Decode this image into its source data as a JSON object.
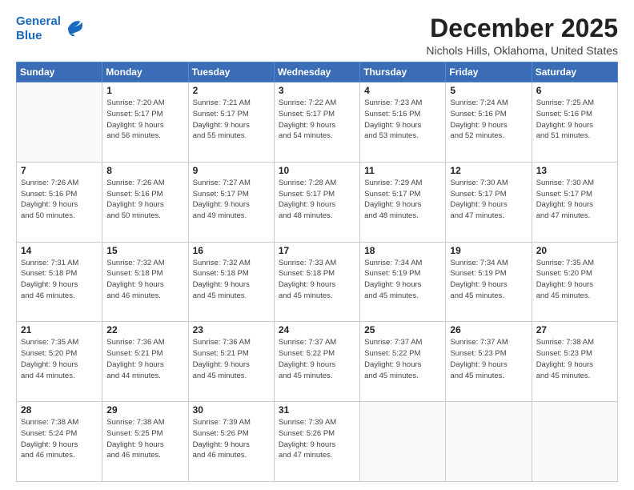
{
  "header": {
    "logo_line1": "General",
    "logo_line2": "Blue",
    "month": "December 2025",
    "location": "Nichols Hills, Oklahoma, United States"
  },
  "weekdays": [
    "Sunday",
    "Monday",
    "Tuesday",
    "Wednesday",
    "Thursday",
    "Friday",
    "Saturday"
  ],
  "weeks": [
    [
      {
        "day": "",
        "info": ""
      },
      {
        "day": "1",
        "info": "Sunrise: 7:20 AM\nSunset: 5:17 PM\nDaylight: 9 hours\nand 56 minutes."
      },
      {
        "day": "2",
        "info": "Sunrise: 7:21 AM\nSunset: 5:17 PM\nDaylight: 9 hours\nand 55 minutes."
      },
      {
        "day": "3",
        "info": "Sunrise: 7:22 AM\nSunset: 5:17 PM\nDaylight: 9 hours\nand 54 minutes."
      },
      {
        "day": "4",
        "info": "Sunrise: 7:23 AM\nSunset: 5:16 PM\nDaylight: 9 hours\nand 53 minutes."
      },
      {
        "day": "5",
        "info": "Sunrise: 7:24 AM\nSunset: 5:16 PM\nDaylight: 9 hours\nand 52 minutes."
      },
      {
        "day": "6",
        "info": "Sunrise: 7:25 AM\nSunset: 5:16 PM\nDaylight: 9 hours\nand 51 minutes."
      }
    ],
    [
      {
        "day": "7",
        "info": "Sunrise: 7:26 AM\nSunset: 5:16 PM\nDaylight: 9 hours\nand 50 minutes."
      },
      {
        "day": "8",
        "info": "Sunrise: 7:26 AM\nSunset: 5:16 PM\nDaylight: 9 hours\nand 50 minutes."
      },
      {
        "day": "9",
        "info": "Sunrise: 7:27 AM\nSunset: 5:17 PM\nDaylight: 9 hours\nand 49 minutes."
      },
      {
        "day": "10",
        "info": "Sunrise: 7:28 AM\nSunset: 5:17 PM\nDaylight: 9 hours\nand 48 minutes."
      },
      {
        "day": "11",
        "info": "Sunrise: 7:29 AM\nSunset: 5:17 PM\nDaylight: 9 hours\nand 48 minutes."
      },
      {
        "day": "12",
        "info": "Sunrise: 7:30 AM\nSunset: 5:17 PM\nDaylight: 9 hours\nand 47 minutes."
      },
      {
        "day": "13",
        "info": "Sunrise: 7:30 AM\nSunset: 5:17 PM\nDaylight: 9 hours\nand 47 minutes."
      }
    ],
    [
      {
        "day": "14",
        "info": "Sunrise: 7:31 AM\nSunset: 5:18 PM\nDaylight: 9 hours\nand 46 minutes."
      },
      {
        "day": "15",
        "info": "Sunrise: 7:32 AM\nSunset: 5:18 PM\nDaylight: 9 hours\nand 46 minutes."
      },
      {
        "day": "16",
        "info": "Sunrise: 7:32 AM\nSunset: 5:18 PM\nDaylight: 9 hours\nand 45 minutes."
      },
      {
        "day": "17",
        "info": "Sunrise: 7:33 AM\nSunset: 5:18 PM\nDaylight: 9 hours\nand 45 minutes."
      },
      {
        "day": "18",
        "info": "Sunrise: 7:34 AM\nSunset: 5:19 PM\nDaylight: 9 hours\nand 45 minutes."
      },
      {
        "day": "19",
        "info": "Sunrise: 7:34 AM\nSunset: 5:19 PM\nDaylight: 9 hours\nand 45 minutes."
      },
      {
        "day": "20",
        "info": "Sunrise: 7:35 AM\nSunset: 5:20 PM\nDaylight: 9 hours\nand 45 minutes."
      }
    ],
    [
      {
        "day": "21",
        "info": "Sunrise: 7:35 AM\nSunset: 5:20 PM\nDaylight: 9 hours\nand 44 minutes."
      },
      {
        "day": "22",
        "info": "Sunrise: 7:36 AM\nSunset: 5:21 PM\nDaylight: 9 hours\nand 44 minutes."
      },
      {
        "day": "23",
        "info": "Sunrise: 7:36 AM\nSunset: 5:21 PM\nDaylight: 9 hours\nand 45 minutes."
      },
      {
        "day": "24",
        "info": "Sunrise: 7:37 AM\nSunset: 5:22 PM\nDaylight: 9 hours\nand 45 minutes."
      },
      {
        "day": "25",
        "info": "Sunrise: 7:37 AM\nSunset: 5:22 PM\nDaylight: 9 hours\nand 45 minutes."
      },
      {
        "day": "26",
        "info": "Sunrise: 7:37 AM\nSunset: 5:23 PM\nDaylight: 9 hours\nand 45 minutes."
      },
      {
        "day": "27",
        "info": "Sunrise: 7:38 AM\nSunset: 5:23 PM\nDaylight: 9 hours\nand 45 minutes."
      }
    ],
    [
      {
        "day": "28",
        "info": "Sunrise: 7:38 AM\nSunset: 5:24 PM\nDaylight: 9 hours\nand 46 minutes."
      },
      {
        "day": "29",
        "info": "Sunrise: 7:38 AM\nSunset: 5:25 PM\nDaylight: 9 hours\nand 46 minutes."
      },
      {
        "day": "30",
        "info": "Sunrise: 7:39 AM\nSunset: 5:26 PM\nDaylight: 9 hours\nand 46 minutes."
      },
      {
        "day": "31",
        "info": "Sunrise: 7:39 AM\nSunset: 5:26 PM\nDaylight: 9 hours\nand 47 minutes."
      },
      {
        "day": "",
        "info": ""
      },
      {
        "day": "",
        "info": ""
      },
      {
        "day": "",
        "info": ""
      }
    ]
  ]
}
